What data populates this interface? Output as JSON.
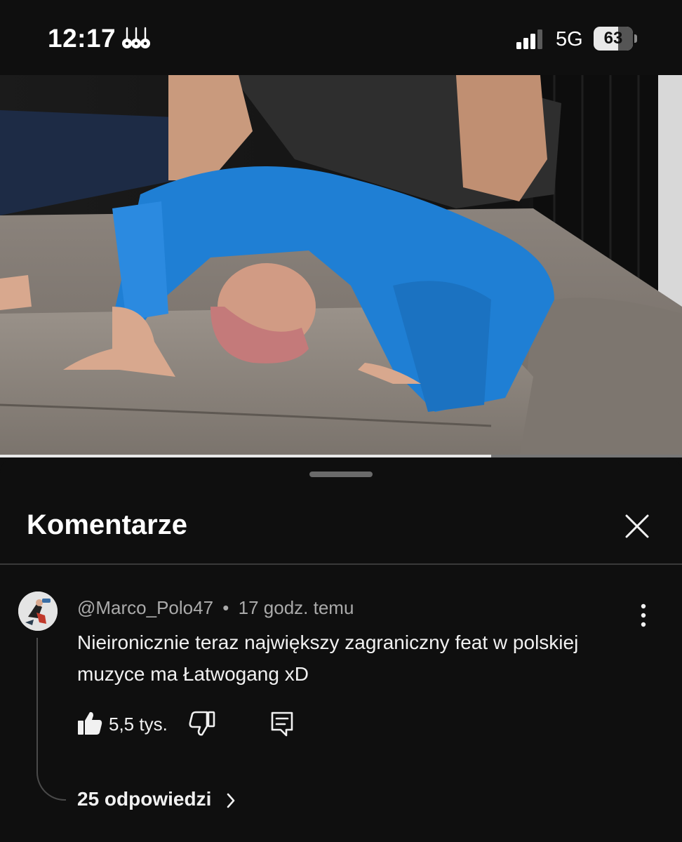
{
  "status_bar": {
    "time": "12:17",
    "network": "5G",
    "battery": "63",
    "battery_level_percent": 63,
    "app_icon": "concert-guitars-icon",
    "signal_icon": "cellular-signal-icon"
  },
  "video": {
    "progress_fraction": 0.72
  },
  "comments_panel": {
    "title": "Komentarze",
    "close_icon": "close-icon"
  },
  "comment": {
    "author": "@Marco_Polo47",
    "separator": "•",
    "time_ago": "17 godz. temu",
    "text": "Nieironicznie teraz największy zagraniczny feat w polskiej muzyce ma Łatwogang xD",
    "likes": "5,5 tys.",
    "replies_label": "25 odpowiedzi",
    "icons": {
      "like": "thumbs-up-icon",
      "dislike": "thumbs-down-icon",
      "reply": "reply-comment-icon",
      "more": "more-vertical-icon",
      "chevron": "chevron-right-icon"
    }
  },
  "colors": {
    "background": "#0f0f0f",
    "text_primary": "#f1f1f1",
    "text_secondary": "#aaaaaa",
    "divider": "#3a3a3a"
  }
}
